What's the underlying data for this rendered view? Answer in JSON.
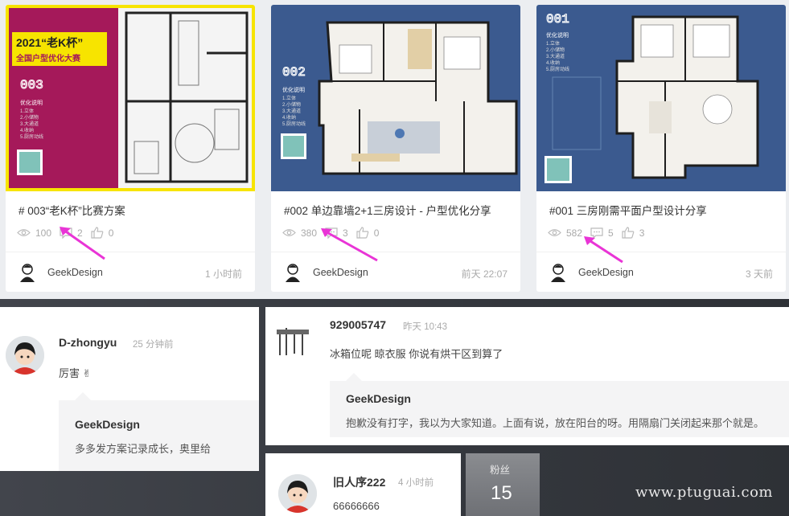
{
  "cards": [
    {
      "title": "# 003“老K杯”比赛方案",
      "views": "100",
      "comments": "2",
      "likes": "0",
      "author": "GeekDesign",
      "time": "1 小时前",
      "thumb": {
        "bg": "#a5195a",
        "badge_line1": "2021“老K杯”",
        "badge_line2": "全国户型优化大赛",
        "number": "003",
        "notes_title": "优化说明",
        "notes": [
          "1.立体",
          "2.小储物",
          "3.大通道",
          "4.收纳",
          "5.厨房动线"
        ]
      }
    },
    {
      "title": "#002 单边靠墙2+1三房设计 - 户型优化分享",
      "views": "380",
      "comments": "3",
      "likes": "0",
      "author": "GeekDesign",
      "time": "前天 22:07",
      "thumb": {
        "bg": "#3b5a8f",
        "number": "002",
        "notes_title": "优化说明",
        "notes": [
          "1.立体",
          "2.小储物",
          "3.大通道",
          "4.收纳",
          "5.厨房动线"
        ]
      }
    },
    {
      "title": "#001 三房刚需平面户型设计分享",
      "views": "582",
      "comments": "5",
      "likes": "3",
      "author": "GeekDesign",
      "time": "3 天前",
      "thumb": {
        "bg": "#3b5a8f",
        "number": "001",
        "notes_title": "优化说明",
        "notes": [
          "1.立体",
          "2.小储物",
          "3.大通道",
          "4.收纳",
          "5.厨房动线"
        ]
      }
    }
  ],
  "comments": [
    {
      "name": "D-zhongyu",
      "time": "25 分钟前",
      "text": "厉害 ✌",
      "reply_name": "GeekDesign",
      "reply_text": "多多发方案记录成长，奥里给"
    },
    {
      "name": "929005747",
      "time": "昨天 10:43",
      "text": "冰箱位呢    晾衣服   你说有烘干区到算了",
      "reply_name": "GeekDesign",
      "reply_text": "抱歉没有打字，我以为大家知道。上面有说，放在阳台的呀。用隔扇门关闭起来那个就是。"
    },
    {
      "name": "旧人序222",
      "time": "4 小时前",
      "text": "66666666"
    }
  ],
  "fans": {
    "label": "粉丝",
    "count": "15"
  },
  "watermark": "www.ptuguai.com",
  "colors": {
    "arrow": "#e934d6",
    "yellow": "#f7e400",
    "magenta": "#a5195a",
    "blue": "#3b5a8f"
  }
}
